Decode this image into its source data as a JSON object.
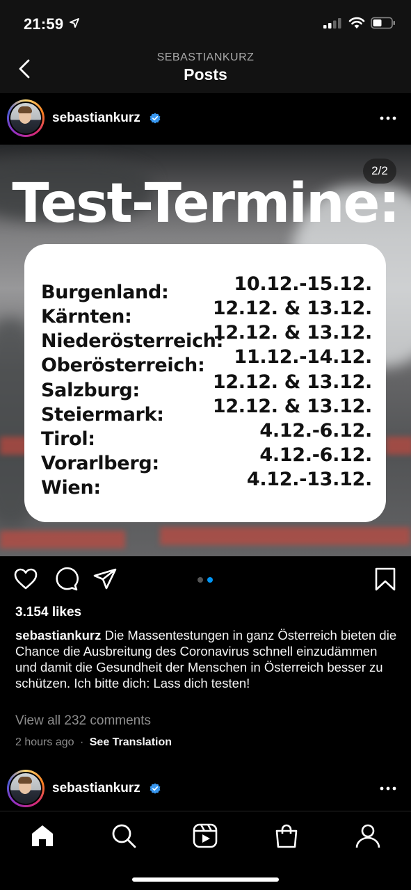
{
  "status_bar": {
    "time": "21:59",
    "icons": [
      "location-arrow-icon",
      "cellular-signal-icon",
      "wifi-icon",
      "battery-icon"
    ]
  },
  "header": {
    "subtitle": "SEBASTIANKURZ",
    "title": "Posts",
    "back_icon": "chevron-left-icon"
  },
  "post": {
    "username": "sebastiankurz",
    "verified": true,
    "page_indicator": "2/2",
    "image": {
      "title": "Test-Termine:",
      "rows": [
        {
          "region": "Burgenland:",
          "dates": "10.12.-15.12."
        },
        {
          "region": "Kärnten:",
          "dates": "12.12. & 13.12."
        },
        {
          "region": "Niederösterreich:",
          "dates": "12.12. & 13.12."
        },
        {
          "region": "Oberösterreich:",
          "dates": "11.12.-14.12."
        },
        {
          "region": "Salzburg:",
          "dates": "12.12. & 13.12."
        },
        {
          "region": "Steiermark:",
          "dates": "12.12. & 13.12."
        },
        {
          "region": "Tirol:",
          "dates": "4.12.-6.12."
        },
        {
          "region": "Vorarlberg:",
          "dates": "4.12.-6.12."
        },
        {
          "region": "Wien:",
          "dates": "4.12.-13.12."
        }
      ]
    },
    "carousel": {
      "count": 2,
      "active": 2,
      "active_color": "#0095f6",
      "inactive_color": "#555555"
    },
    "likes": "3.154 likes",
    "caption_user": "sebastiankurz",
    "caption_text": "Die Massentestungen in ganz Österreich bieten die Chance die Ausbreitung des Coronavirus schnell einzudämmen und damit die Gesundheit der Menschen in Österreich besser zu schützen. Ich bitte dich: Lass dich testen!",
    "view_comments": "View all 232 comments",
    "time_ago": "2 hours ago",
    "separator": "·",
    "see_translation": "See Translation"
  },
  "next_post": {
    "username": "sebastiankurz",
    "verified": true
  },
  "bottom_nav": {
    "items": [
      "home-icon",
      "search-icon",
      "reels-icon",
      "shop-icon",
      "profile-icon"
    ]
  },
  "colors": {
    "verified_blue": "#3897f0",
    "background": "#000000",
    "bar_background": "#121212"
  }
}
